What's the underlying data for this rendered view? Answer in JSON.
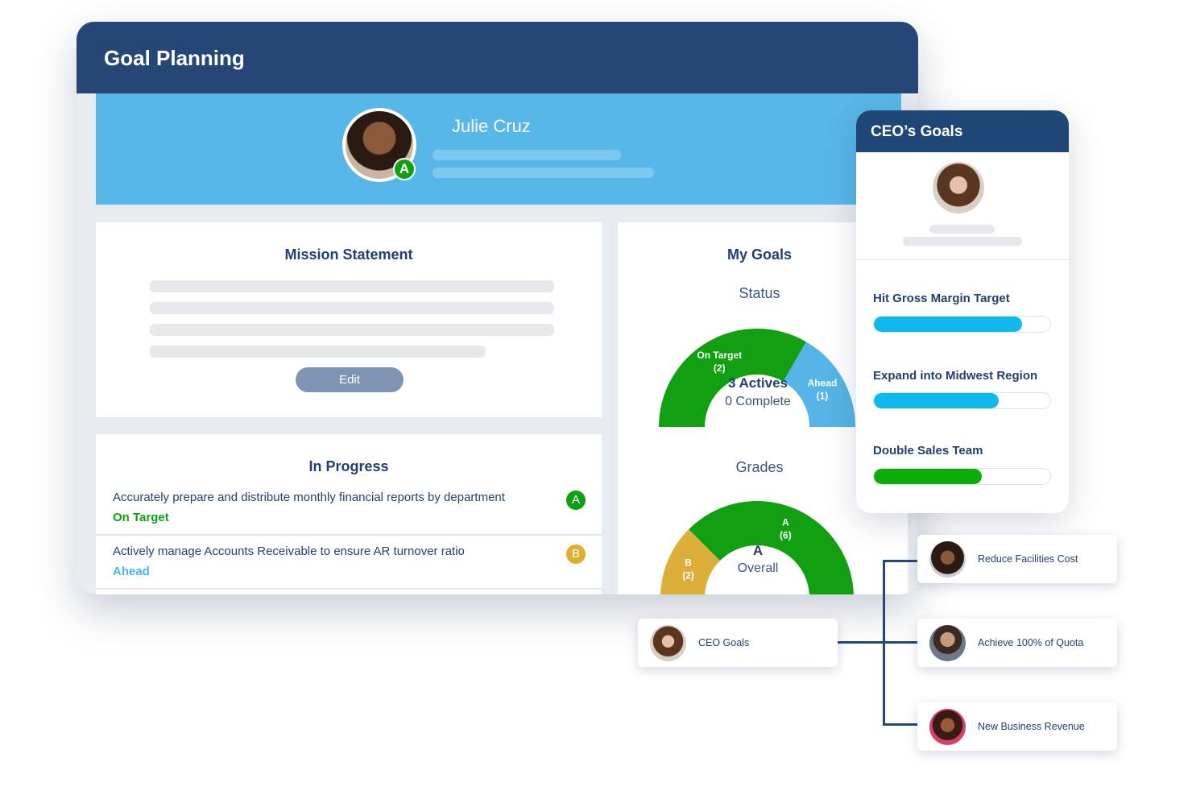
{
  "header": {
    "title": "Goal Planning"
  },
  "profile": {
    "name": "Julie Cruz",
    "grade_badge": "A"
  },
  "mission": {
    "title": "Mission Statement",
    "edit_label": "Edit"
  },
  "in_progress": {
    "title": "In Progress",
    "items": [
      {
        "text": "Accurately prepare and distribute monthly financial reports by department",
        "status": "On Target",
        "status_color": "#12a012",
        "grade": "A",
        "grade_color": "#12a012"
      },
      {
        "text": "Actively manage Accounts Receivable to ensure AR turnover ratio",
        "status": "Ahead",
        "status_color": "#4fb3e8",
        "grade": "B",
        "grade_color": "#e0ad2f"
      }
    ]
  },
  "my_goals": {
    "title": "My Goals",
    "status": {
      "label": "Status",
      "center_main": "3 Actives",
      "center_sub": "0 Complete",
      "segments": [
        {
          "label": "On Target",
          "count_label": "(2)",
          "value": 2,
          "color": "#12a012"
        },
        {
          "label": "Ahead",
          "count_label": "(1)",
          "value": 1,
          "color": "#56b4e6"
        }
      ]
    },
    "grades": {
      "label": "Grades",
      "center_main": "A",
      "center_sub": "Overall",
      "segments": [
        {
          "label": "B",
          "count_label": "(2)",
          "value": 2,
          "color": "#dcae3a"
        },
        {
          "label": "A",
          "count_label": "(6)",
          "value": 6,
          "color": "#12a012"
        }
      ]
    }
  },
  "ceo_goals": {
    "title": "CEO’s Goals",
    "goals": [
      {
        "label": "Hit Gross Margin Target",
        "progress": 0.84,
        "color": "#0fb9ec"
      },
      {
        "label": "Expand into Midwest Region",
        "progress": 0.71,
        "color": "#0fb9ec"
      },
      {
        "label": "Double Sales Team",
        "progress": 0.61,
        "color": "#0aad0a"
      }
    ]
  },
  "tree": {
    "root": "CEO Goals",
    "children": [
      "Reduce Facilities Cost",
      "Achieve 100% of Quota",
      "New Business Revenue"
    ]
  }
}
